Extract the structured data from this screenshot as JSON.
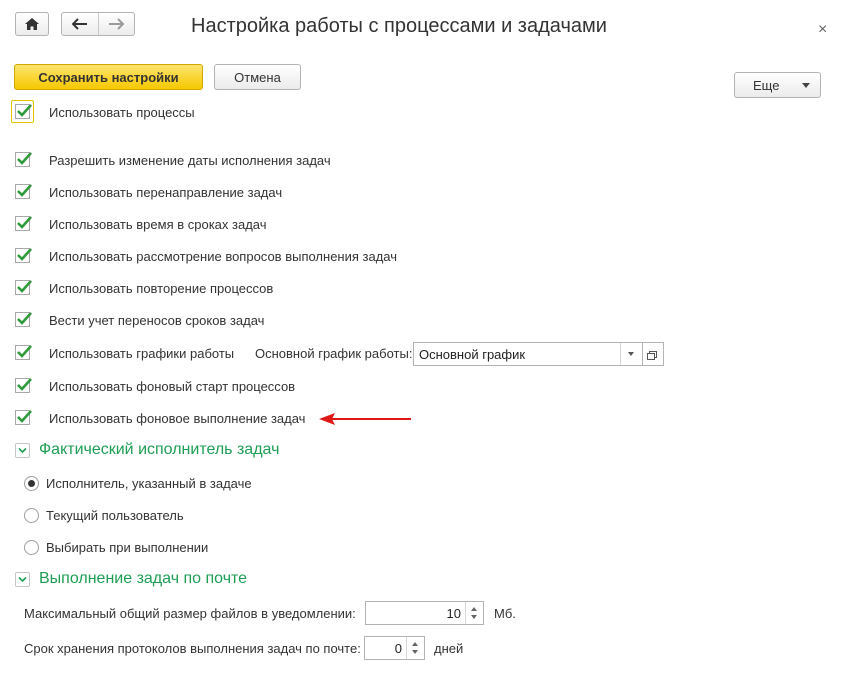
{
  "window": {
    "title": "Настройка работы с процессами и задачами",
    "close_glyph": "×"
  },
  "toolbar": {
    "save_label": "Сохранить настройки",
    "cancel_label": "Отмена",
    "more_label": "Еще"
  },
  "settings": {
    "use_processes": {
      "label": "Использовать процессы",
      "checked": true
    },
    "items": [
      {
        "label": "Разрешить изменение даты исполнения задач",
        "checked": true
      },
      {
        "label": "Использовать перенаправление задач",
        "checked": true
      },
      {
        "label": "Использовать время в сроках задач",
        "checked": true
      },
      {
        "label": "Использовать рассмотрение вопросов выполнения задач",
        "checked": true
      },
      {
        "label": "Использовать повторение процессов",
        "checked": true
      },
      {
        "label": "Вести учет переносов сроков задач",
        "checked": true
      },
      {
        "label": "Использовать графики работы",
        "checked": true
      },
      {
        "label": "Использовать фоновый старт процессов",
        "checked": true
      },
      {
        "label": "Использовать фоновое выполнение задач",
        "checked": true
      }
    ],
    "schedule": {
      "label": "Основной график работы:",
      "value": "Основной график"
    }
  },
  "performer_group": {
    "title": "Фактический исполнитель задач",
    "options": [
      {
        "label": "Исполнитель, указанный в задаче",
        "selected": true
      },
      {
        "label": "Текущий пользователь",
        "selected": false
      },
      {
        "label": "Выбирать при выполнении",
        "selected": false
      }
    ]
  },
  "email_group": {
    "title": "Выполнение задач по почте",
    "max_size": {
      "label": "Максимальный общий размер файлов в уведомлении:",
      "value": "10",
      "unit": "Мб."
    },
    "retention": {
      "label": "Срок хранения протоколов выполнения задач по почте:",
      "value": "0",
      "unit": "дней"
    }
  },
  "colors": {
    "accent_green": "#1e9e54",
    "check_green": "#2e9a3a",
    "primary_yellow": "#f5c800",
    "annotation_red": "#e01818"
  },
  "icons": [
    "home-icon",
    "back-arrow-icon",
    "forward-arrow-icon",
    "close-icon",
    "checkmark-icon",
    "chevron-down-icon",
    "open-icon",
    "annotation-arrow-icon"
  ]
}
